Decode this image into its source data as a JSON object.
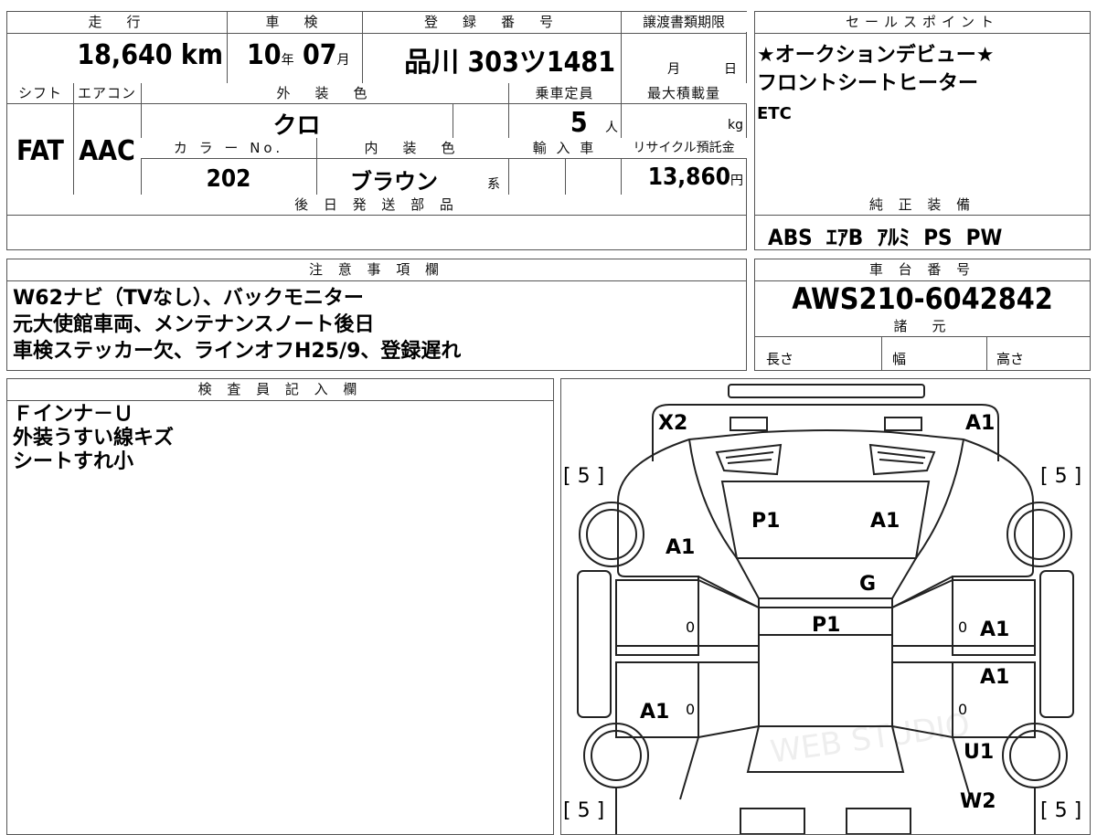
{
  "top": {
    "mileage_header": "走　行",
    "mileage": "18,640",
    "mileage_unit": "km",
    "inspection_header": "車　検",
    "inspection_year": "10",
    "inspection_year_unit": "年",
    "inspection_month": "07",
    "inspection_month_unit": "月",
    "registration_header": "登　録　番　号",
    "registration": "品川 303ツ1481",
    "transfer_header": "譲渡書類期限",
    "transfer_month_unit": "月",
    "transfer_day_unit": "日",
    "shift_header": "シフト",
    "ac_header": "エアコン",
    "exterior_header": "外　装　色",
    "capacity_header": "乗車定員",
    "maxload_header": "最大積載量",
    "shift": "FAT",
    "ac": "AAC",
    "exterior": "クロ",
    "capacity": "5",
    "capacity_unit": "人",
    "maxload_unit": "kg",
    "color_no_header": "カ ラ ー No.",
    "interior_header": "内　装　色",
    "import_header": "輸 入 車",
    "recycle_header": "リサイクル預託金",
    "color_no": "202",
    "interior": "ブラウン",
    "interior_unit": "系",
    "recycle": "13,860",
    "recycle_unit": "円",
    "later_parts_header": "後 日 発 送 部 品"
  },
  "sales": {
    "header": "セールスポイント",
    "lines": [
      "★オークションデビュー★",
      "フロントシートヒーター",
      "ETC"
    ]
  },
  "equipment": {
    "header": "純 正 装 備",
    "value": "ABS  ｴｱB  ｱﾙﾐ  PS  PW"
  },
  "notes": {
    "header": "注 意 事 項 欄",
    "lines": [
      "W62ナビ（TVなし）、バックモニター",
      "元大使館車両、メンテナンスノート後日",
      "車検ステッカー欠、ラインオフH25/9、登録遅れ"
    ]
  },
  "chassis": {
    "header": "車 台 番 号",
    "value": "AWS210-6042842",
    "spec_header": "諸　元",
    "length": "長さ",
    "width": "幅",
    "height": "高さ"
  },
  "inspector": {
    "header": "検 査 員 記 入 欄",
    "lines": [
      "Ｆインナ－Ｕ",
      "外装うすい線キズ",
      "シートすれ小"
    ]
  },
  "diagram": {
    "tire_left_top": "[ 5 ]",
    "tire_right_top": "[ 5 ]",
    "tire_left_bottom": "[ 5 ]",
    "tire_right_bottom": "[ 5 ]",
    "marks": {
      "x2": "X2",
      "a1_front_right": "A1",
      "p1_hood": "P1",
      "a1_hood": "A1",
      "a1_left_fender": "A1",
      "g_windshield": "G",
      "p1_roof": "P1",
      "a1_right_door1": "A1",
      "a1_right_door2": "A1",
      "a1_left_door": "A1",
      "u1_right": "U1",
      "w2_right": "W2",
      "zero_l1": "0",
      "zero_r1": "0",
      "zero_l2": "0",
      "zero_r2": "0"
    },
    "watermark": "WEB STUDIO"
  }
}
